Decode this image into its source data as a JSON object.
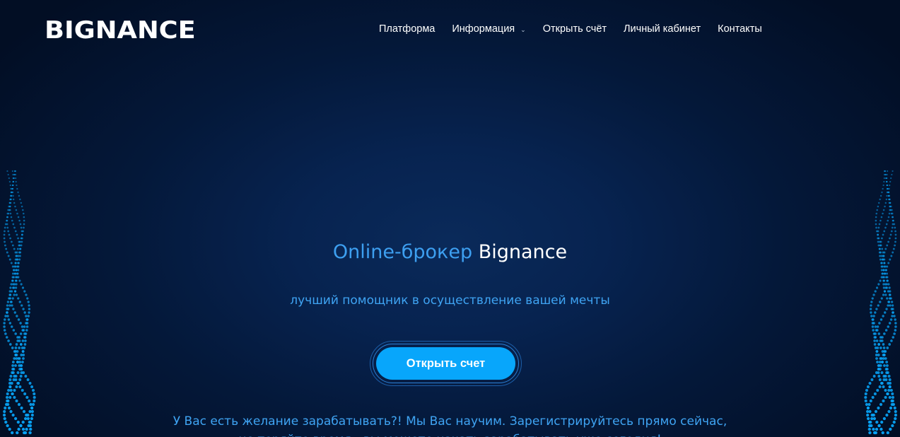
{
  "header": {
    "logo_text": "BIGNANCE",
    "nav": [
      {
        "label": "Платформа"
      },
      {
        "label": "Информация",
        "has_dropdown": true
      },
      {
        "label": "Открыть счёт"
      },
      {
        "label": "Личный кабинет"
      },
      {
        "label": "Контакты"
      }
    ]
  },
  "hero": {
    "title_highlight": "Online-брокер",
    "title_brand": "Bignance",
    "subtitle": "лучший помощник в осуществление вашей мечты",
    "cta_label": "Открыть счет",
    "description": "У Вас есть желание зарабатывать?! Мы Вас научим. Зарегистрируйтесь прямо сейчас, не теряйте время - вы можете начать зарабатывать уже сегодня!"
  },
  "colors": {
    "accent": "#08a6fb",
    "text_accent": "#3fa4f3",
    "background": "#041839"
  },
  "icons": {
    "dropdown": "chevron-down-icon",
    "decor": "dotted-wave-decoration"
  }
}
